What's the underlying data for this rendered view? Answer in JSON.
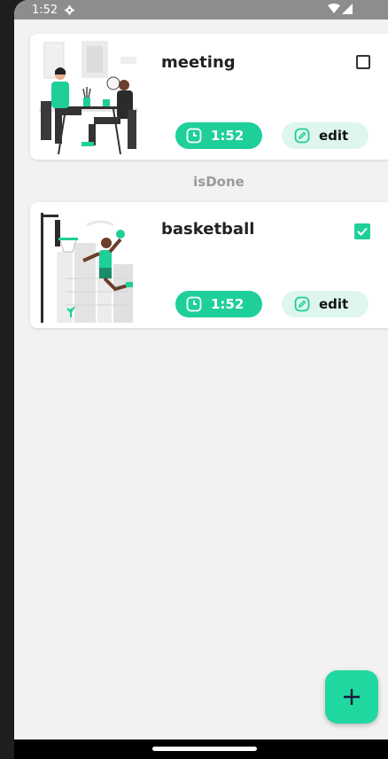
{
  "status_bar": {
    "time": "1:52",
    "icons": [
      "gear-icon",
      "wifi-icon",
      "signal-icon"
    ]
  },
  "tasks": [
    {
      "title": "meeting",
      "time": "1:52",
      "edit_label": "edit",
      "done": false,
      "illustration": "meeting-illustration"
    },
    {
      "title": "basketball",
      "time": "1:52",
      "edit_label": "edit",
      "done": true,
      "illustration": "basketball-illustration"
    }
  ],
  "section_label": "isDone",
  "fab": {
    "icon": "plus-icon"
  },
  "colors": {
    "accent": "#1fcf9a",
    "edit_bg": "#def6ee",
    "background": "#f2f2f2",
    "status_bar": "#8d8d8d"
  }
}
